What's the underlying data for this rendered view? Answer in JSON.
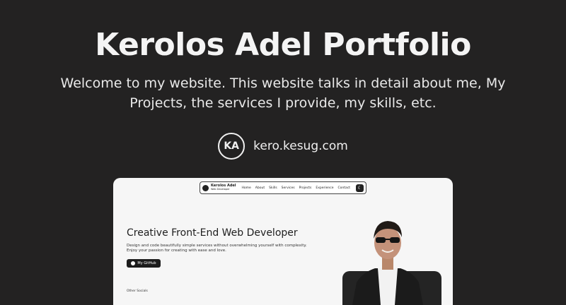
{
  "header": {
    "title": "Kerolos Adel Portfolio",
    "subtitle": "Welcome to my website. This website talks in detail about me, My Projects, the services I provide, my skills, etc.",
    "logo_text": "KA",
    "site_url": "kero.kesug.com"
  },
  "preview": {
    "nav": {
      "brand_name": "Kerolos Adel",
      "brand_tagline": "Web Developer",
      "links": [
        "Home",
        "About",
        "Skills",
        "Services",
        "Projects",
        "Experience",
        "Contact"
      ]
    },
    "hero_title": "Creative Front-End Web Developer",
    "hero_description": "Design and code beautifully simple services without overwhelming yourself with complexity. Enjoy your passion for creating with ease and love.",
    "github_button": "My GitHub",
    "other_socials": "Other Socials"
  },
  "colors": {
    "background": "#232222",
    "card": "#f6f6f6",
    "text": "#f4f4f4"
  }
}
